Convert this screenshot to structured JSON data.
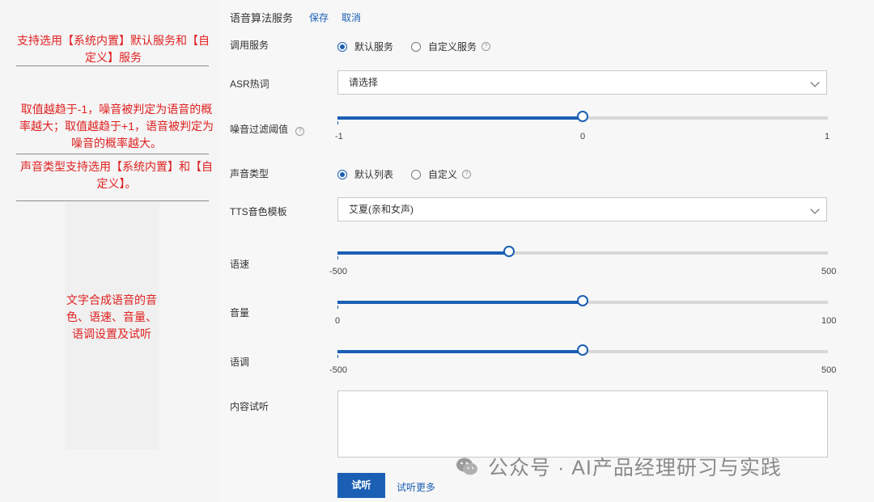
{
  "annotations": {
    "a1": "支持选用【系统内置】默认服务和【自定义】服务",
    "a2": "取值越趋于-1，噪音被判定为语音的概率越大；取值越趋于+1，语音被判定为噪音的概率越大。",
    "a3": "声音类型支持选用【系统内置】和【自定义】。",
    "a4": "文字合成语音的音色、语速、音量、语调设置及试听"
  },
  "header": {
    "title": "语音算法服务",
    "save": "保存",
    "cancel": "取消"
  },
  "service": {
    "label": "调用服务",
    "opt_default": "默认服务",
    "opt_custom": "自定义服务"
  },
  "asr": {
    "label": "ASR热词",
    "placeholder": "请选择"
  },
  "noise": {
    "label": "噪音过滤阈值",
    "value": 0,
    "min": "-1",
    "mid": "0",
    "max": "1"
  },
  "voice_type": {
    "label": "声音类型",
    "opt_default": "默认列表",
    "opt_custom": "自定义"
  },
  "tts": {
    "label": "TTS音色模板",
    "value": "艾夏(亲和女声)"
  },
  "speed": {
    "label": "语速",
    "value": -150,
    "min": "-500",
    "max": "500"
  },
  "volume": {
    "label": "音量",
    "value": 50,
    "min": "0",
    "max": "100"
  },
  "pitch": {
    "label": "语调",
    "value": 0,
    "min": "-500",
    "max": "500"
  },
  "content": {
    "label": "内容试听"
  },
  "actions": {
    "listen": "试听",
    "more": "试听更多"
  },
  "watermark": {
    "text": "公众号 · AI产品经理研习与实践"
  },
  "colors": {
    "accent": "#1a5fb4",
    "annotation": "#e02020"
  }
}
